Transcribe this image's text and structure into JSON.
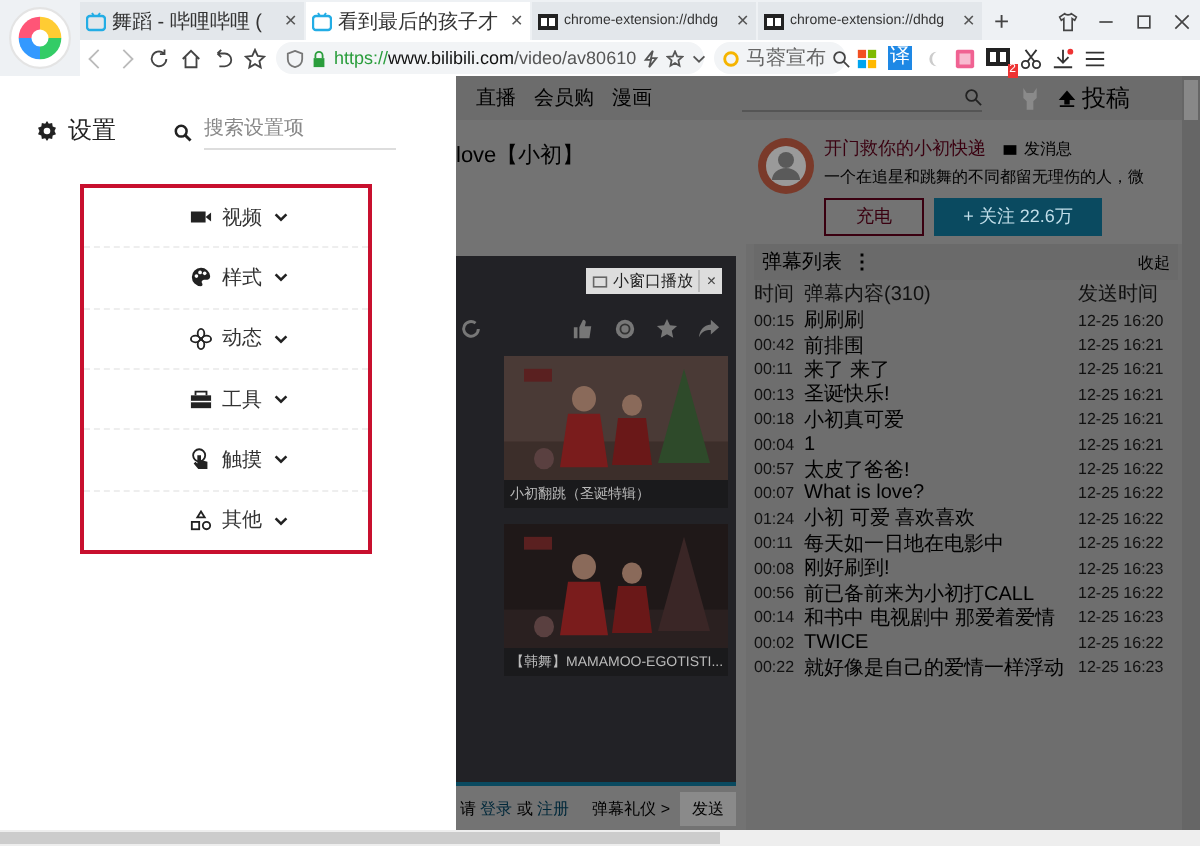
{
  "browser": {
    "tabs": [
      {
        "title": "舞蹈 - 哔哩哔哩 (",
        "close": "✕",
        "selected": false,
        "kind": "bili"
      },
      {
        "title": "看到最后的孩子才",
        "close": "✕",
        "selected": true,
        "kind": "bili"
      },
      {
        "title": "chrome-extension://dhdg",
        "close": "✕",
        "selected": false,
        "kind": "ext"
      },
      {
        "title": "chrome-extension://dhdg",
        "close": "✕",
        "selected": false,
        "kind": "ext"
      }
    ],
    "new_tab": "+",
    "url_scheme": "https://",
    "url_host": "www.bilibili.com",
    "url_path": "/video/av80610",
    "search_text": "马蓉宣布",
    "translate_label": "译",
    "badge": "2"
  },
  "settings": {
    "title": "设置",
    "search_placeholder": "搜索设置项",
    "sections": [
      {
        "label": "视频"
      },
      {
        "label": "样式"
      },
      {
        "label": "动态"
      },
      {
        "label": "工具"
      },
      {
        "label": "触摸"
      },
      {
        "label": "其他"
      }
    ]
  },
  "site": {
    "nav": [
      "直播",
      "会员购",
      "漫画"
    ],
    "upload": "投稿",
    "video_title": "love【小初】",
    "uploader": "开门救你的小初快递",
    "message": "发消息",
    "bio": "一个在追星和跳舞的不同都留无理伤的人，微",
    "charge": "充电",
    "follow": "+ 关注 22.6万",
    "mini_player": "小窗口播放",
    "mini_close": "×",
    "thumbnails": [
      {
        "caption": "小初翻跳（圣诞特辑）"
      },
      {
        "caption": "【韩舞】MAMAMOO-EGOTISTI..."
      }
    ],
    "login_prefix": "请",
    "login": "登录",
    "login_or": "或",
    "register": "注册",
    "etiquette": "弹幕礼仪 >",
    "send": "发送"
  },
  "danmaku": {
    "title": "弹幕列表",
    "menu": "⋮",
    "collapse": "收起",
    "columns": [
      "时间",
      "弹幕内容(310)",
      "发送时间"
    ],
    "rows": [
      [
        "00:15",
        "刷刷刷",
        "12-25 16:20"
      ],
      [
        "00:42",
        "前排围",
        "12-25 16:21"
      ],
      [
        "00:11",
        "来了 来了",
        "12-25 16:21"
      ],
      [
        "00:13",
        "圣诞快乐!",
        "12-25 16:21"
      ],
      [
        "00:18",
        "小初真可爱",
        "12-25 16:21"
      ],
      [
        "00:04",
        "1",
        "12-25 16:21"
      ],
      [
        "00:57",
        "太皮了爸爸!",
        "12-25 16:22"
      ],
      [
        "00:07",
        "What is love?",
        "12-25 16:22"
      ],
      [
        "01:24",
        "小初 可爱 喜欢喜欢",
        "12-25 16:22"
      ],
      [
        "00:11",
        "每天如一日地在电影中",
        "12-25 16:22"
      ],
      [
        "00:08",
        "刚好刷到!",
        "12-25 16:23"
      ],
      [
        "00:56",
        "前已备前来为小初打CALL",
        "12-25 16:22"
      ],
      [
        "00:14",
        "和书中 电视剧中 那爱着爱情",
        "12-25 16:23"
      ],
      [
        "00:02",
        "TWICE",
        "12-25 16:22"
      ],
      [
        "00:22",
        "就好像是自己的爱情一样浮动",
        "12-25 16:23"
      ]
    ]
  }
}
